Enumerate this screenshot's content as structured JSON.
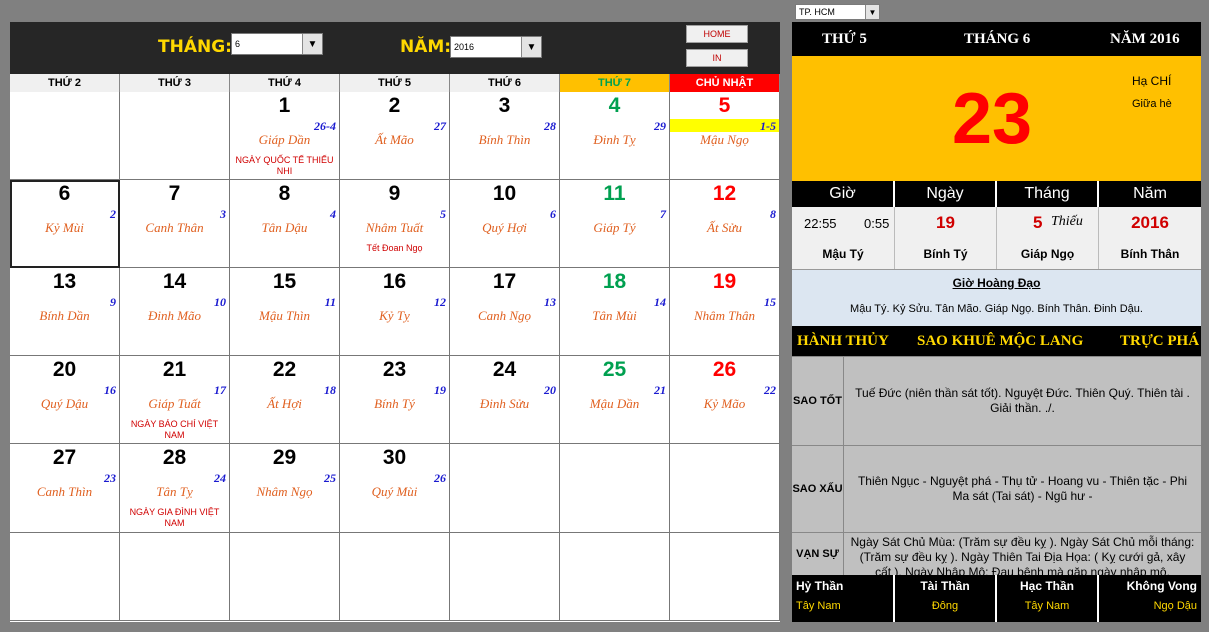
{
  "header": {
    "month_label": "THÁNG:",
    "month_value": "6",
    "year_label": "NĂM:",
    "year_value": "2016",
    "home_button": "HOME",
    "print_button": "IN"
  },
  "weekdays": [
    "THỨ 2",
    "THỨ 3",
    "THỨ 4",
    "THỨ 5",
    "THỨ 6",
    "THỨ 7",
    "CHỦ NHẬT"
  ],
  "calendar": {
    "days": [
      {
        "day": "",
        "lunar": "",
        "canchi": "",
        "event": ""
      },
      {
        "day": "",
        "lunar": "",
        "canchi": "",
        "event": ""
      },
      {
        "day": "1",
        "lunar": "26-4",
        "canchi": "Giáp Dần",
        "event": "NGÀY QUỐC TẾ THIẾU NHI"
      },
      {
        "day": "2",
        "lunar": "27",
        "canchi": "Ất Mão",
        "event": ""
      },
      {
        "day": "3",
        "lunar": "28",
        "canchi": "Bính Thìn",
        "event": ""
      },
      {
        "day": "4",
        "lunar": "29",
        "canchi": "Đinh Tỵ",
        "event": ""
      },
      {
        "day": "5",
        "lunar": "1-5",
        "canchi": "Mậu Ngọ",
        "event": ""
      },
      {
        "day": "6",
        "lunar": "2",
        "canchi": "Kỷ Mùi",
        "event": ""
      },
      {
        "day": "7",
        "lunar": "3",
        "canchi": "Canh Thân",
        "event": ""
      },
      {
        "day": "8",
        "lunar": "4",
        "canchi": "Tân Dậu",
        "event": ""
      },
      {
        "day": "9",
        "lunar": "5",
        "canchi": "Nhâm Tuất",
        "event": "Tết Đoan Ngọ"
      },
      {
        "day": "10",
        "lunar": "6",
        "canchi": "Quý Hợi",
        "event": ""
      },
      {
        "day": "11",
        "lunar": "7",
        "canchi": "Giáp Tý",
        "event": ""
      },
      {
        "day": "12",
        "lunar": "8",
        "canchi": "Ất Sửu",
        "event": ""
      },
      {
        "day": "13",
        "lunar": "9",
        "canchi": "Bính Dần",
        "event": ""
      },
      {
        "day": "14",
        "lunar": "10",
        "canchi": "Đinh Mão",
        "event": ""
      },
      {
        "day": "15",
        "lunar": "11",
        "canchi": "Mậu Thìn",
        "event": ""
      },
      {
        "day": "16",
        "lunar": "12",
        "canchi": "Kỷ Tỵ",
        "event": ""
      },
      {
        "day": "17",
        "lunar": "13",
        "canchi": "Canh Ngọ",
        "event": ""
      },
      {
        "day": "18",
        "lunar": "14",
        "canchi": "Tân Mùi",
        "event": ""
      },
      {
        "day": "19",
        "lunar": "15",
        "canchi": "Nhâm Thân",
        "event": ""
      },
      {
        "day": "20",
        "lunar": "16",
        "canchi": "Quý Dậu",
        "event": ""
      },
      {
        "day": "21",
        "lunar": "17",
        "canchi": "Giáp Tuất",
        "event": "NGÀY BÁO CHÍ VIỆT NAM"
      },
      {
        "day": "22",
        "lunar": "18",
        "canchi": "Ất Hợi",
        "event": ""
      },
      {
        "day": "23",
        "lunar": "19",
        "canchi": "Bính Tý",
        "event": ""
      },
      {
        "day": "24",
        "lunar": "20",
        "canchi": "Đinh Sửu",
        "event": ""
      },
      {
        "day": "25",
        "lunar": "21",
        "canchi": "Mậu Dần",
        "event": ""
      },
      {
        "day": "26",
        "lunar": "22",
        "canchi": "Kỷ Mão",
        "event": ""
      },
      {
        "day": "27",
        "lunar": "23",
        "canchi": "Canh Thìn",
        "event": ""
      },
      {
        "day": "28",
        "lunar": "24",
        "canchi": "Tân Tỵ",
        "event": "NGÀY GIA ĐÌNH VIỆT NAM"
      },
      {
        "day": "29",
        "lunar": "25",
        "canchi": "Nhâm Ngọ",
        "event": ""
      },
      {
        "day": "30",
        "lunar": "26",
        "canchi": "Quý Mùi",
        "event": ""
      }
    ]
  },
  "detail": {
    "city": "TP. HCM",
    "weekday": "THỨ 5",
    "month": "THÁNG 6",
    "year": "NĂM 2016",
    "day_big": "23",
    "solar_term": "Hạ CHÍ",
    "solar_term_desc": "Giữa hè",
    "cols": {
      "hour_label": "Giờ",
      "day_label": "Ngày",
      "month_label": "Tháng",
      "year_label": "Năm",
      "hour_from": "22:55",
      "hour_to": "0:55",
      "lunar_day": "19",
      "lunar_month": "5",
      "lunar_month_type": "Thiếu",
      "lunar_year": "2016",
      "hour_canchi": "Mậu Tý",
      "day_canchi": "Bính Tý",
      "month_canchi": "Giáp Ngọ",
      "year_canchi": "Bính Thân"
    },
    "hoang_dao_title": "Giờ Hoàng Đạo",
    "hoang_dao_value": "Mậu Tý.  Kỷ Sửu.  Tân Mão.  Giáp Ngọ.  Bính Thân.  Đinh Dậu.",
    "hanh": "HÀNH THỦY",
    "sao": "SAO KHUÊ MỘC LANG",
    "truc": "TRỰC PHÁ",
    "sao_tot_label": "SAO TỐT",
    "sao_tot": "Tuế Đức (niên thần sát tốt). Nguyệt Đức. Thiên Quý. Thiên tài . Giải thần. ./.",
    "sao_xau_label": "SAO XẤU",
    "sao_xau": "Thiên Ngục - Nguyệt phá - Thụ tử - Hoang vu - Thiên tặc - Phi Ma sát (Tai sát) - Ngũ hư -",
    "van_su_label": "VẠN SỰ",
    "van_su": "Ngày Sát Chủ Mùa: (Trăm sự đều kỵ ). Ngày Sát Chủ mỗi tháng: (Trăm sự đều kỵ ). Ngày Thiên Tai Địa Họa: ( Kỵ cưới gả, xây cất ). Ngày Nhập Mộ: Đau bệnh mà gặp ngày nhập mộ.",
    "directions": [
      {
        "label": "Hỷ Thần",
        "value": "Tây Nam"
      },
      {
        "label": "Tài Thần",
        "value": "Đông"
      },
      {
        "label": "Hạc Thần",
        "value": "Tây Nam"
      },
      {
        "label": "Không Vong",
        "value": "Ngọ Dậu"
      }
    ]
  },
  "colors": {
    "weekday": "#000000",
    "saturday": "#00a050",
    "sunday": "#ff0000",
    "lunar": "#1a1ad0",
    "canchi": "#e06020",
    "event": "#d00000",
    "accent": "#ffc000"
  }
}
